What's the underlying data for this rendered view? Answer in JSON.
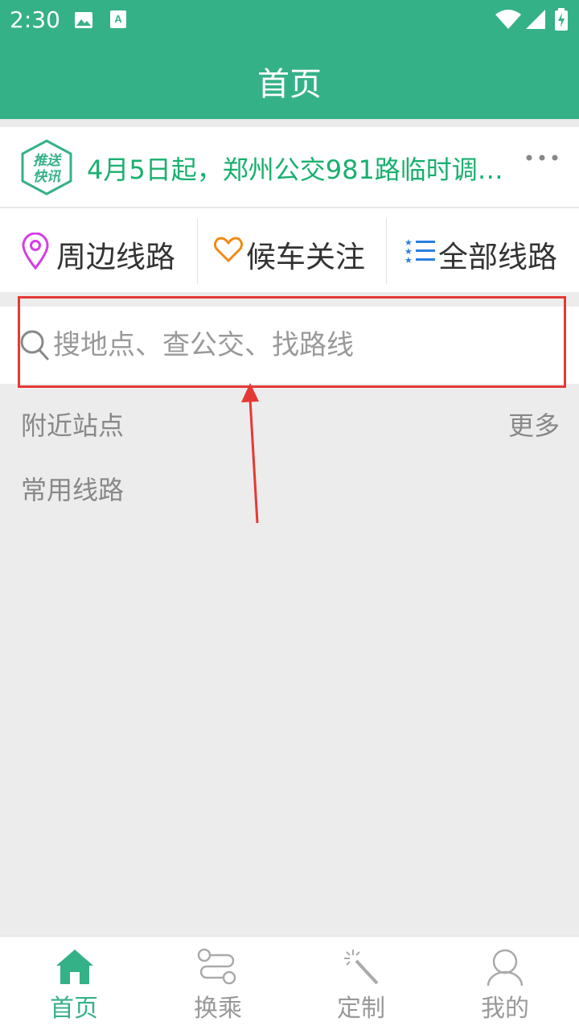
{
  "status_bar": {
    "time": "2:30",
    "icons": [
      "image-icon",
      "a-keyboard-icon",
      "wifi-icon",
      "signal-icon",
      "battery-charging-icon"
    ]
  },
  "app_bar": {
    "title": "首页"
  },
  "notice": {
    "badge_line1": "推送",
    "badge_line2": "快讯",
    "text": "4月5日起，郑州公交981路临时调…",
    "more_icon": "more-horizontal-icon"
  },
  "quick_actions": [
    {
      "label": "周边线路",
      "icon": "location-pin-icon"
    },
    {
      "label": "候车关注",
      "icon": "heart-icon"
    },
    {
      "label": "全部线路",
      "icon": "star-list-icon"
    }
  ],
  "search": {
    "placeholder": "搜地点、查公交、找路线",
    "icon": "search-icon"
  },
  "sections": {
    "nearby_stops": "附近站点",
    "nearby_more": "更多",
    "frequent_routes": "常用线路"
  },
  "bottom_nav": [
    {
      "label": "首页",
      "icon": "home-icon",
      "active": true
    },
    {
      "label": "换乘",
      "icon": "transfer-route-icon",
      "active": false
    },
    {
      "label": "定制",
      "icon": "magic-wand-icon",
      "active": false
    },
    {
      "label": "我的",
      "icon": "person-icon",
      "active": false
    }
  ],
  "colors": {
    "primary": "#35b187",
    "notice_text": "#19b06e",
    "annotation": "#e53935",
    "pin_icon": "#d63ee8",
    "heart_icon": "#f08a12",
    "list_icon": "#2a7fe0"
  }
}
